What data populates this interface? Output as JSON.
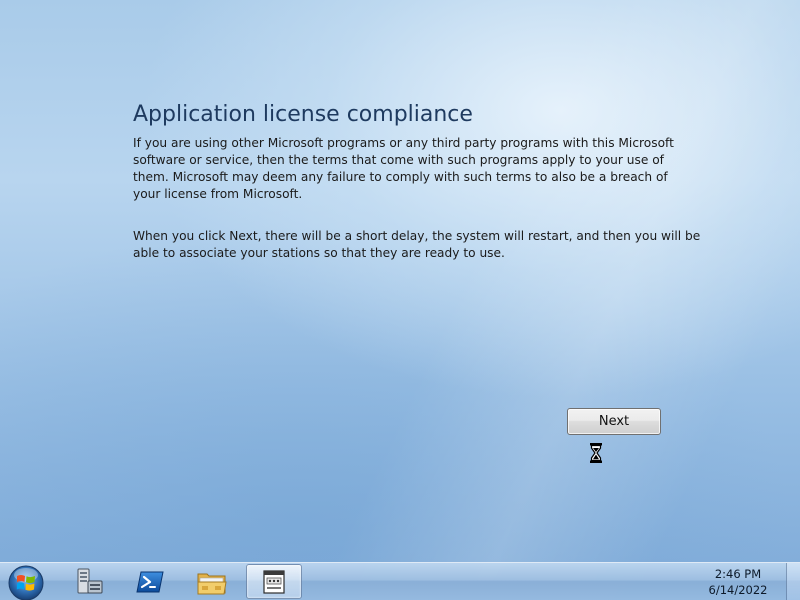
{
  "setup": {
    "title": "Application license compliance",
    "paragraph1": "If you are using other Microsoft programs or any third party programs with this Microsoft software or service, then the terms that come with such programs apply to your use of them.  Microsoft may deem any failure to comply with such terms to also be a breach of your license from Microsoft.",
    "paragraph2": "When you click Next, there will be a short delay, the system will restart, and then you will be able to associate your stations so that they are ready to use.",
    "next_label": "Next"
  },
  "taskbar": {
    "start_icon": "windows-start-orb",
    "items": [
      {
        "icon": "server-manager-icon"
      },
      {
        "icon": "powershell-icon"
      },
      {
        "icon": "folder-icon"
      },
      {
        "icon": "application-window-icon",
        "active": true
      }
    ],
    "time": "2:46 PM",
    "date": "6/14/2022"
  },
  "cursor": {
    "icon": "hourglass-cursor"
  }
}
